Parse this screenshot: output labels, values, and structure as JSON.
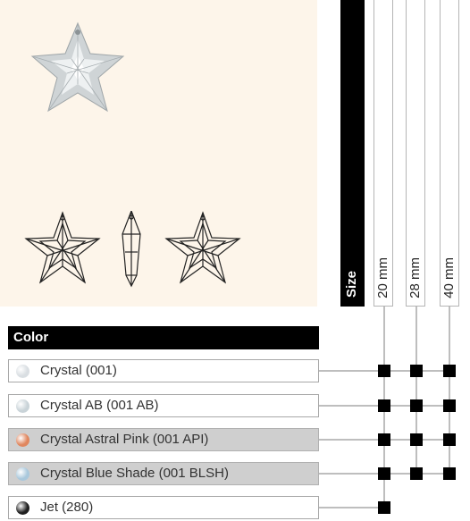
{
  "size_header": "Size",
  "sizes": [
    "20 mm",
    "28 mm",
    "40 mm"
  ],
  "color_header": "Color",
  "colors": [
    {
      "label": "Crystal (001)",
      "swatch": "#d9dee2",
      "availability": [
        true,
        true,
        true
      ]
    },
    {
      "label": "Crystal AB (001 AB)",
      "swatch": "#c9d3d8",
      "availability": [
        true,
        true,
        true
      ]
    },
    {
      "label": "Crystal Astral Pink (001 API)",
      "swatch": "#e0865e",
      "availability": [
        true,
        true,
        true
      ]
    },
    {
      "label": "Crystal Blue Shade (001 BLSH)",
      "swatch": "#a9c8dc",
      "availability": [
        true,
        true,
        true
      ]
    },
    {
      "label": "Jet (280)",
      "swatch": "#1f1f1f",
      "availability": [
        true,
        false,
        false
      ]
    }
  ],
  "icons": {
    "photo": "star-crystal-photo",
    "drawings": "star-line-drawings"
  }
}
